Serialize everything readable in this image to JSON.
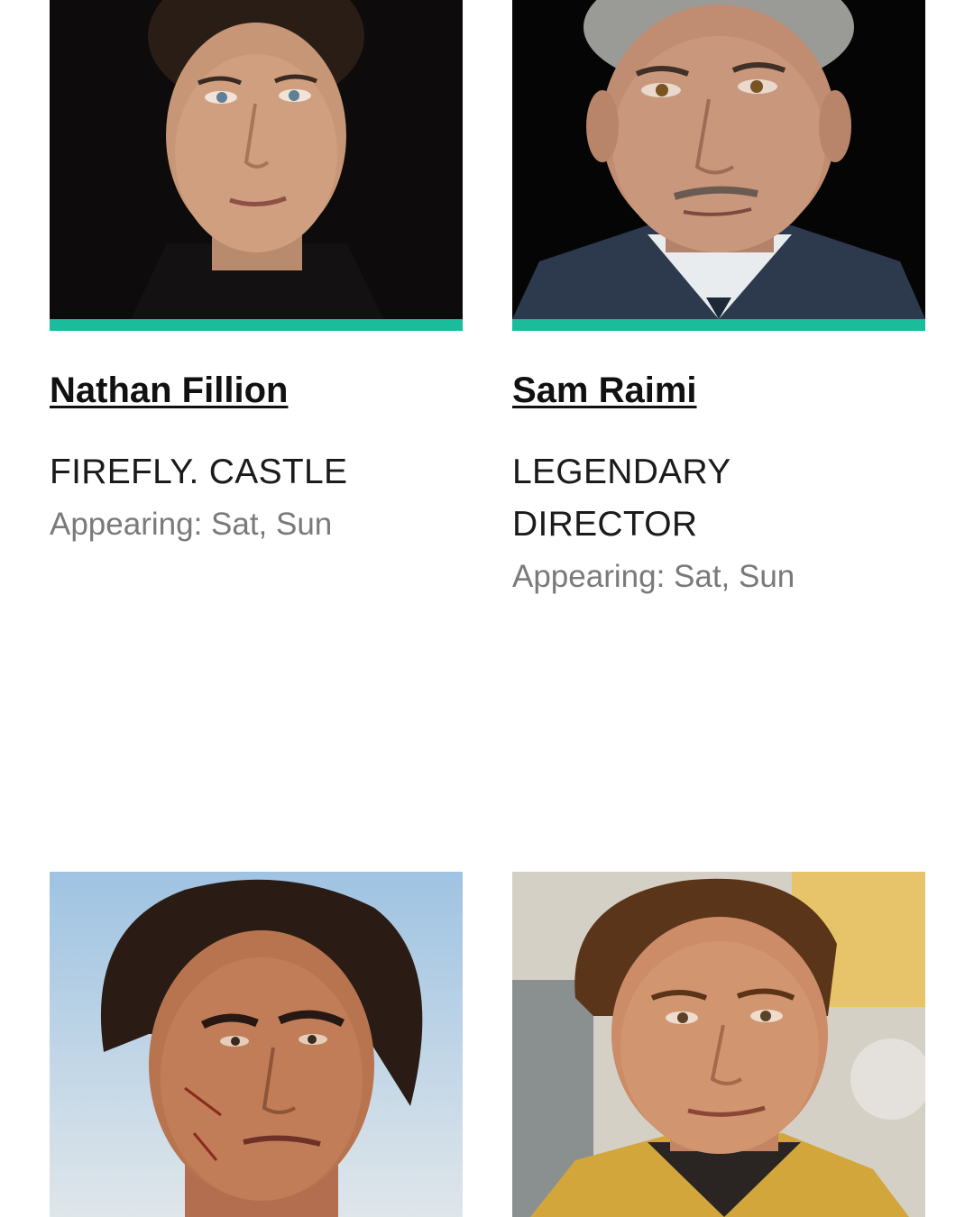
{
  "guests": [
    {
      "name": "Nathan Fillion",
      "tagline": "FIREFLY. CASTLE",
      "appearing": "Appearing: Sat, Sun",
      "photo_alt": "portrait-photo"
    },
    {
      "name": "Sam Raimi",
      "tagline": "LEGENDARY DIRECTOR",
      "appearing": "Appearing: Sat, Sun",
      "photo_alt": "portrait-photo"
    },
    {
      "photo_alt": "portrait-photo"
    },
    {
      "photo_alt": "portrait-photo"
    }
  ],
  "colors": {
    "accent": "#1abc9c",
    "name_text": "#111111",
    "tagline_text": "#1b1b1b",
    "appearing_text": "#7a7a7a",
    "background": "#ffffff"
  }
}
